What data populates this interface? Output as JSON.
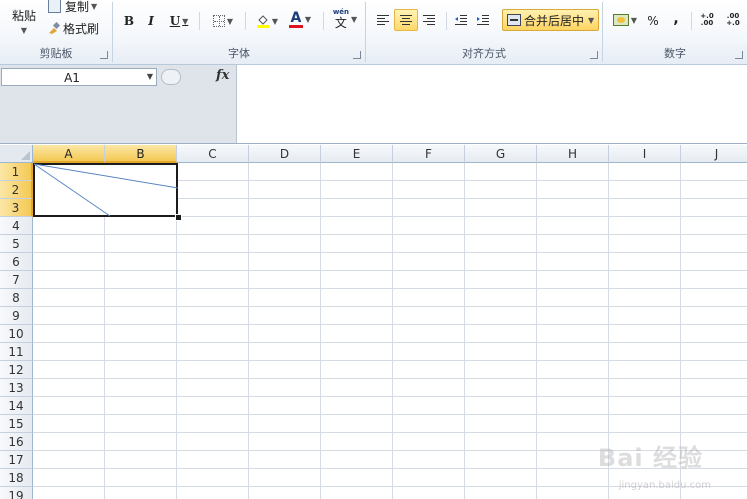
{
  "ribbon": {
    "clipboard": {
      "paste_label": "粘贴",
      "copy_label": "复制",
      "format_painter_label": "格式刷",
      "group_label": "剪贴板"
    },
    "font": {
      "bold": "B",
      "italic": "I",
      "underline": "U",
      "font_color_glyph": "A",
      "phonetic_glyph": "文",
      "phonetic_top": "wén",
      "group_label": "字体"
    },
    "alignment": {
      "merge_label": "合并后居中",
      "group_label": "对齐方式"
    },
    "number": {
      "percent_label": "%",
      "comma_label": ",",
      "inc_decimal": "+.0 .00",
      "dec_decimal": ".00 +.0",
      "group_label": "数字"
    }
  },
  "formula_bar": {
    "name_box_value": "A1",
    "fx_label": "fx",
    "formula_value": ""
  },
  "columns": [
    "A",
    "B",
    "C",
    "D",
    "E",
    "F",
    "G",
    "H",
    "I",
    "J"
  ],
  "rows": [
    "1",
    "2",
    "3",
    "4",
    "5",
    "6",
    "7",
    "8",
    "9",
    "10",
    "11",
    "12",
    "13",
    "14",
    "15",
    "16",
    "17",
    "18",
    "19"
  ],
  "selection": {
    "name": "A1",
    "range": "A1:B3"
  },
  "watermark": {
    "main": "Bai 经验",
    "sub": "jingyan.baidu.com"
  },
  "colors": {
    "accent_selected": "#f4c954",
    "grid_line": "#d4dbe3",
    "header_border": "#9eb6ce"
  }
}
